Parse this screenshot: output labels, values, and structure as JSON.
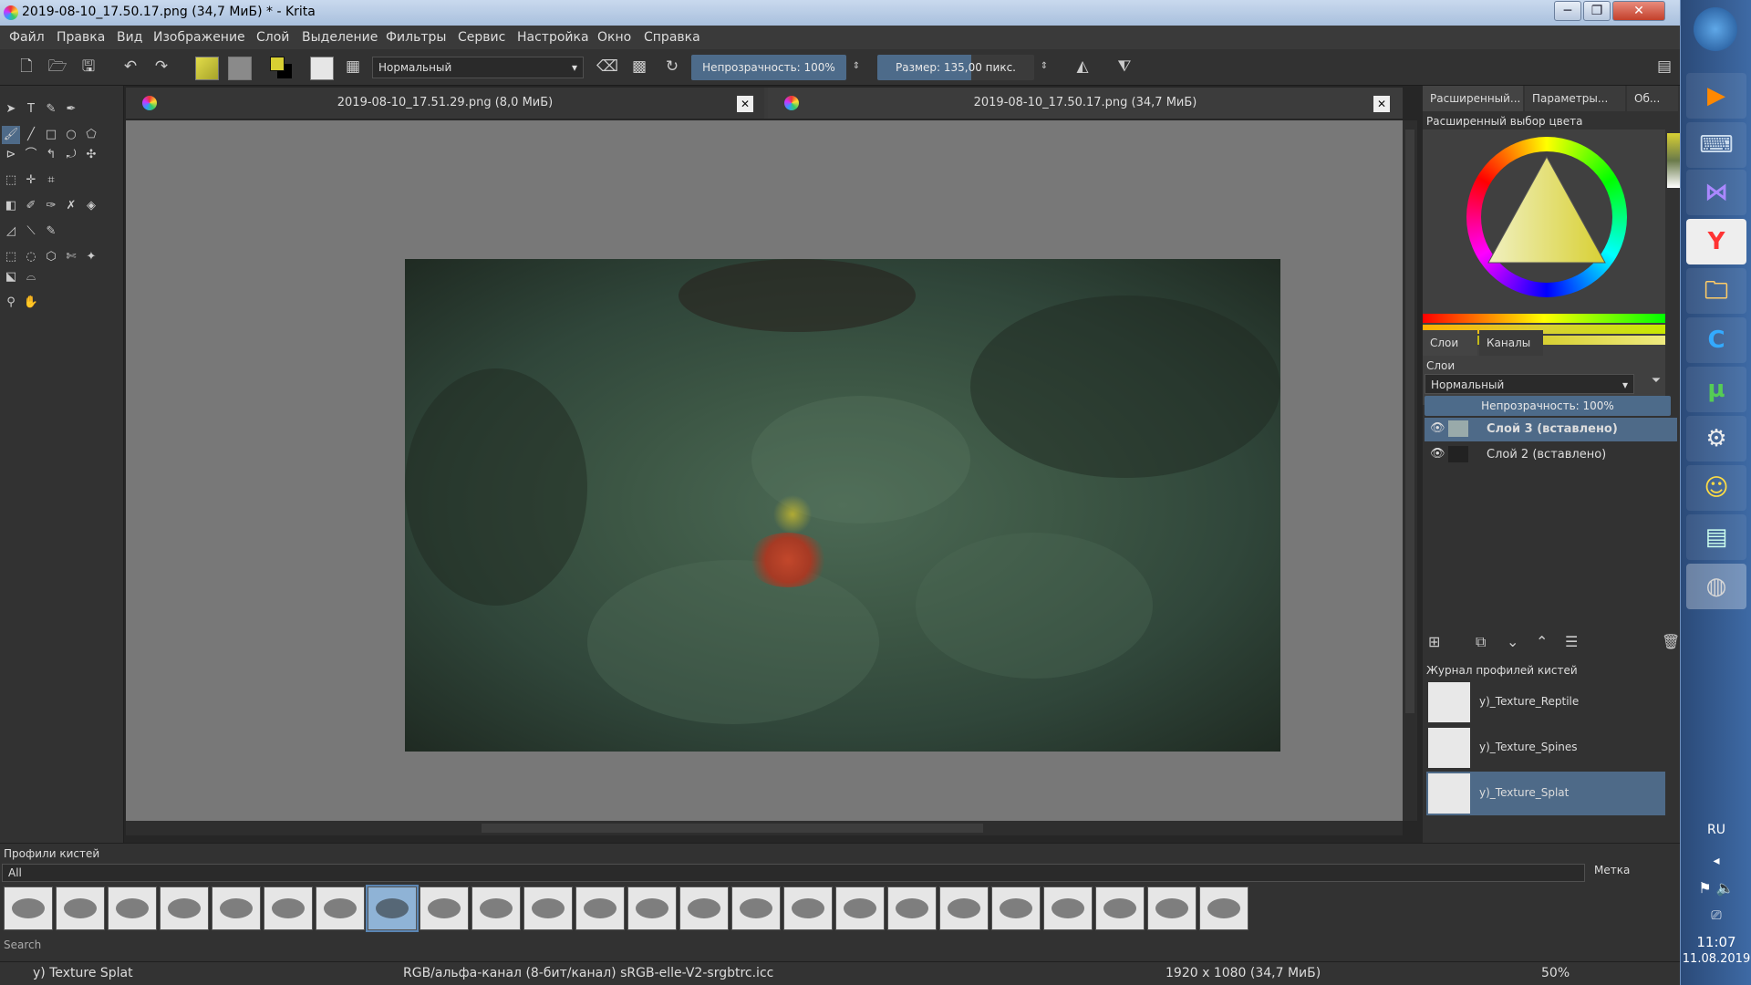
{
  "window": {
    "title": "2019-08-10_17.50.17.png (34,7 МиБ) * - Krita",
    "min": "─",
    "max": "❐",
    "close": "✕"
  },
  "menu": [
    "Файл",
    "Правка",
    "Вид",
    "Изображение",
    "Слой",
    "Выделение",
    "Фильтры",
    "Сервис",
    "Настройка",
    "Окно",
    "Справка"
  ],
  "toolbar": {
    "blend_mode": "Нормальный",
    "opacity_label": "Непрозрачность:  100%",
    "size_label": "Размер:  135,00 пикс.",
    "opacity_value": 100,
    "size_value": 135
  },
  "documents": [
    {
      "name": "2019-08-10_17.51.29.png (8,0 МиБ)",
      "active": false
    },
    {
      "name": "2019-08-10_17.50.17.png (34,7 МиБ)",
      "active": true
    }
  ],
  "dock_tabs": [
    "Расширенный...",
    "Параметры...",
    "Об..."
  ],
  "color_selector": {
    "title": "Расширенный выбор цвета"
  },
  "layers_panel": {
    "tabs": [
      "Слои",
      "Каналы"
    ],
    "title": "Слои",
    "blend_mode": "Нормальный",
    "opacity_label": "Непрозрачность:  100%",
    "layers": [
      {
        "name": "Слой 3 (вставлено)",
        "selected": true
      },
      {
        "name": "Слой 2 (вставлено)",
        "selected": false
      }
    ]
  },
  "brush_history": {
    "title": "Журнал профилей кистей",
    "items": [
      {
        "name": "y)_Texture_Reptile",
        "selected": false
      },
      {
        "name": "y)_Texture_Spines",
        "selected": false
      },
      {
        "name": "y)_Texture_Splat",
        "selected": true
      }
    ]
  },
  "brush_presets": {
    "title": "Профили кистей",
    "filter": "All",
    "tag_label": "Метка",
    "search_placeholder": "Search",
    "count": 24,
    "selected_index": 7
  },
  "status": {
    "brush": "y) Texture Splat",
    "colorspace": "RGB/альфа-канал (8-бит/канал)  sRGB-elle-V2-srgbtrc.icc",
    "dimensions": "1920 x 1080 (34,7 МиБ)",
    "zoom": "50%"
  },
  "taskbar": {
    "lang": "RU",
    "time": "11:07",
    "date": "11.08.2019"
  },
  "colors": {
    "accent": "#4e6a88",
    "panel": "#323232",
    "canvas_bg": "#787878",
    "foreground_color": "#d8d033"
  }
}
